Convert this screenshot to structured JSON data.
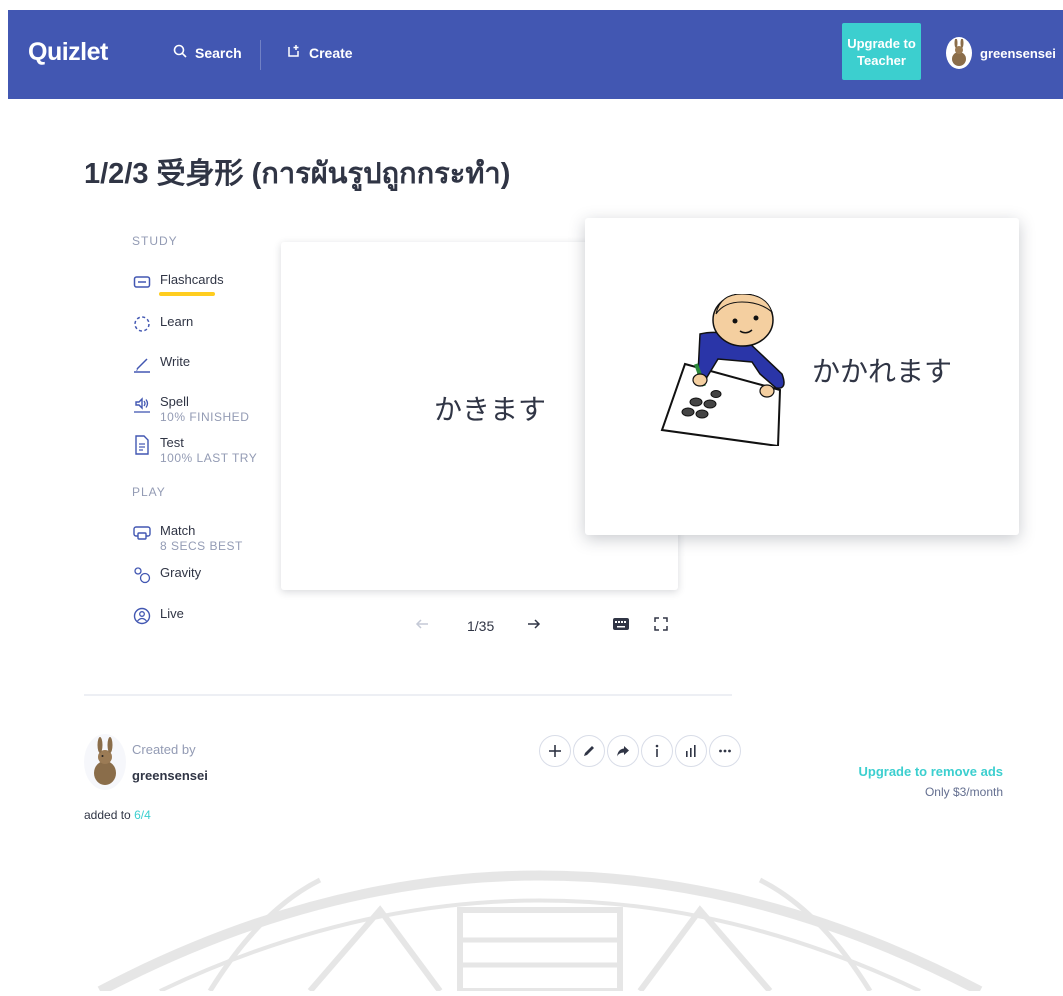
{
  "header": {
    "logo": "Quizlet",
    "search_label": "Search",
    "create_label": "Create",
    "upgrade_label": "Upgrade to Teacher",
    "username": "greensensei"
  },
  "set": {
    "title": "1/2/3 受身形 (การผันรูปถูกกระทำ)"
  },
  "sidebar": {
    "study_heading": "STUDY",
    "play_heading": "PLAY",
    "items": [
      {
        "label": "Flashcards",
        "sub": ""
      },
      {
        "label": "Learn",
        "sub": ""
      },
      {
        "label": "Write",
        "sub": ""
      },
      {
        "label": "Spell",
        "sub": "10% FINISHED"
      },
      {
        "label": "Test",
        "sub": "100% LAST TRY"
      },
      {
        "label": "Match",
        "sub": "8 SECS BEST"
      },
      {
        "label": "Gravity",
        "sub": ""
      },
      {
        "label": "Live",
        "sub": ""
      }
    ],
    "active_item": "Flashcards",
    "active_color": "#ffcd1f"
  },
  "flashcards": {
    "front_term": "かきます",
    "back_term": "かかれます",
    "counter": "1/35"
  },
  "author": {
    "created_by_label": "Created by",
    "name": "greensensei",
    "added_to_label": "added to",
    "added_to_link": "6/4"
  },
  "ads": {
    "upgrade_link": "Upgrade to remove ads",
    "price": "Only $3/month"
  },
  "colors": {
    "header": "#4257b2",
    "accent": "#3ccfcf",
    "active_underline": "#ffcd1f"
  }
}
